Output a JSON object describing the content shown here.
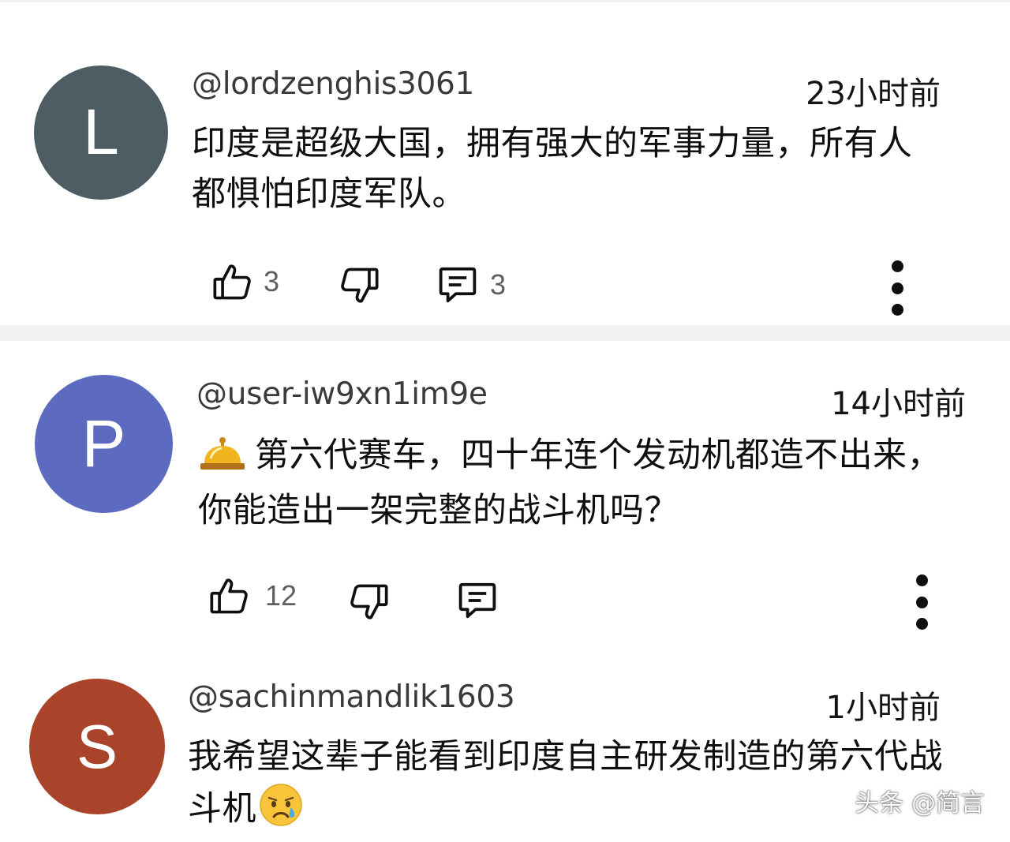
{
  "comments": [
    {
      "avatar_letter": "L",
      "avatar_color": "#4e5c63",
      "handle": "@lordzenghis3061",
      "time": "23小时前",
      "text": "印度是超级大国，拥有强大的军事力量，所有人都惧怕印度军队。",
      "likes": "3",
      "replies": "3"
    },
    {
      "avatar_letter": "P",
      "avatar_color": "#5c6bc0",
      "handle": "@user-iw9xn1im9e",
      "time": "14小时前",
      "lead_icon": "bellhop-bell-emoji",
      "text": "第六代赛车，四十年连个发动机都造不出来，你能造出一架完整的战斗机吗？",
      "likes": "12",
      "replies": ""
    },
    {
      "avatar_letter": "S",
      "avatar_color": "#a9442a",
      "handle": "@sachinmandlik1603",
      "time": "1小时前",
      "text": "我希望这辈子能看到印度自主研发制造的第六代战斗机",
      "trail_icon": "crying-face-emoji",
      "likes": "",
      "replies": ""
    }
  ],
  "icons": {
    "like": "thumbs-up-icon",
    "dislike": "thumbs-down-icon",
    "reply": "comment-icon",
    "more": "more-vertical-icon"
  },
  "watermark": "头条 @简言"
}
